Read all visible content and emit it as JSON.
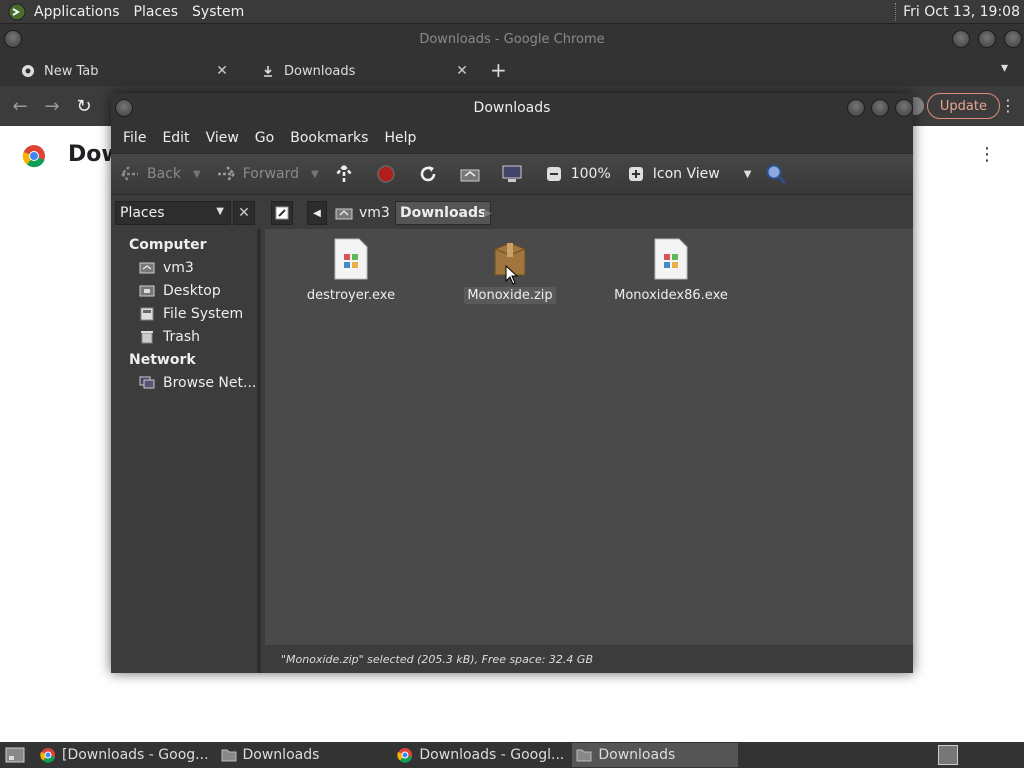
{
  "top_panel": {
    "menus": [
      "Applications",
      "Places",
      "System"
    ],
    "clock": "Fri Oct 13, 19:08"
  },
  "chrome": {
    "window_title": "Downloads - Google Chrome",
    "tabs": [
      {
        "label": "New Tab",
        "close": "✕"
      },
      {
        "label": "Downloads",
        "close": "✕"
      }
    ],
    "new_tab": "+",
    "update_label": "Update",
    "page_heading": "Dow"
  },
  "file_manager": {
    "window_title": "Downloads",
    "menus": [
      "File",
      "Edit",
      "View",
      "Go",
      "Bookmarks",
      "Help"
    ],
    "toolbar": {
      "back": "Back",
      "forward": "Forward",
      "zoom": "100%",
      "view_mode": "Icon View"
    },
    "places_select": "Places",
    "breadcrumbs": [
      "vm3",
      "Downloads"
    ],
    "sidebar": {
      "computer_header": "Computer",
      "computer_items": [
        "vm3",
        "Desktop",
        "File System",
        "Trash"
      ],
      "network_header": "Network",
      "network_items": [
        "Browse Net..."
      ]
    },
    "files": [
      {
        "name": "destroyer.exe",
        "type": "exe"
      },
      {
        "name": "Monoxide.zip",
        "type": "zip",
        "selected": true
      },
      {
        "name": "Monoxidex86.exe",
        "type": "exe"
      }
    ],
    "status": "\"Monoxide.zip\" selected (205.3 kB), Free space: 32.4 GB"
  },
  "taskbar": {
    "items": [
      {
        "label": "[Downloads - Goog...",
        "icon": "chrome-icon"
      },
      {
        "label": "Downloads",
        "icon": "folder-icon"
      },
      {
        "label": "Downloads - Googl...",
        "icon": "chrome-icon"
      },
      {
        "label": "Downloads",
        "icon": "folder-icon",
        "active": true
      }
    ]
  }
}
